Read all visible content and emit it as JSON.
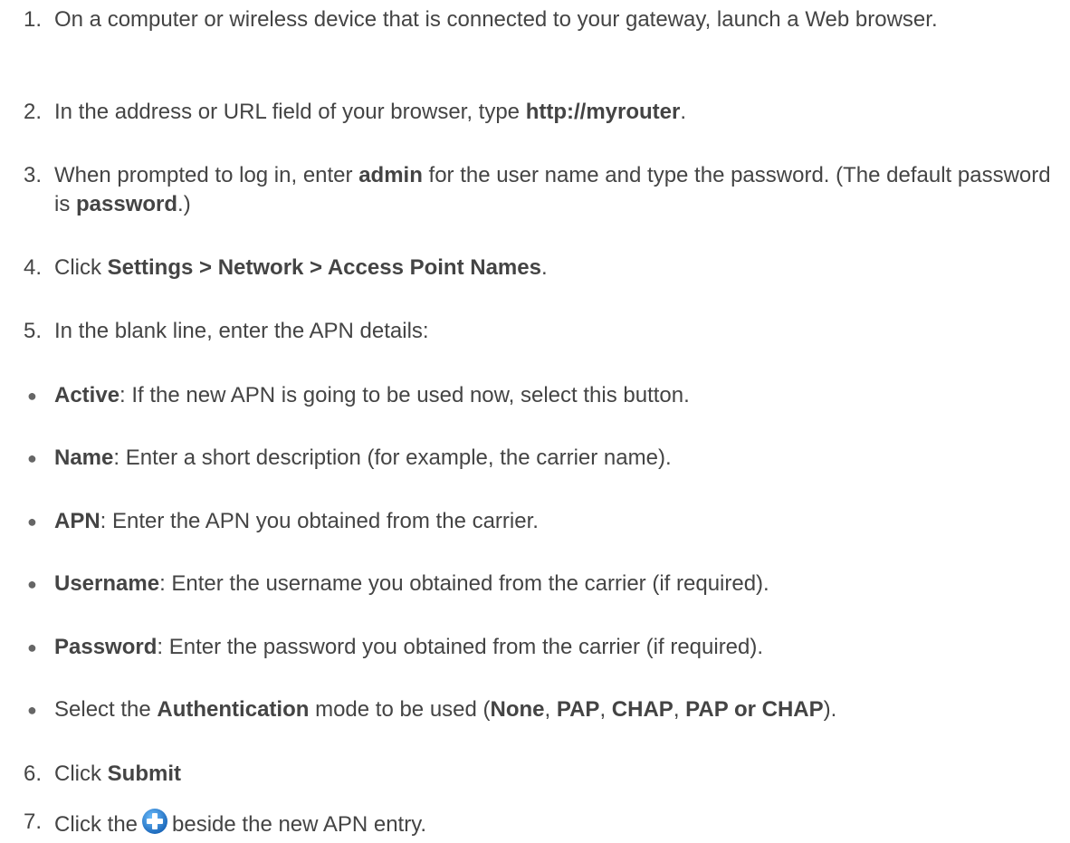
{
  "steps": {
    "s1": {
      "num": "1.",
      "text": "On a computer or wireless device that is connected to your gateway, launch a Web browser."
    },
    "s2": {
      "num": "2.",
      "pre": "In the address or URL field of your browser, type ",
      "bold": "http://myrouter",
      "post": "."
    },
    "s3": {
      "num": "3.",
      "pre": "When prompted to log in, enter ",
      "bold1": "admin",
      "mid": " for the user name and type the password. (The default password is ",
      "bold2": "password",
      "post": ".)"
    },
    "s4": {
      "num": "4.",
      "pre": "Click ",
      "bold": "Settings > Network > Access Point Names",
      "post": "."
    },
    "s5": {
      "num": "5.",
      "text": "In the blank line, enter the APN details:"
    },
    "s6": {
      "num": "6.",
      "pre": "Click ",
      "bold": "Submit"
    },
    "s7": {
      "num": "7.",
      "pre": "Click the",
      "post": "beside the new APN entry.",
      "icon": "plus-circle-icon"
    }
  },
  "bullets": {
    "marker": "●",
    "active": {
      "bold": "Active",
      "text": ": If the new APN is going to be used now, select this button."
    },
    "name": {
      "bold": "Name",
      "text": ": Enter a short description (for example, the carrier name)."
    },
    "apn": {
      "bold": "APN",
      "text": ": Enter the APN you obtained from the carrier."
    },
    "username": {
      "bold": "Username",
      "text": ": Enter the username you obtained from the carrier (if required)."
    },
    "password": {
      "bold": "Password",
      "text": ": Enter the password you obtained from the carrier (if required)."
    },
    "auth": {
      "pre": "Select the ",
      "bold": "Authentication",
      "mid": " mode to be used (",
      "opt1": "None",
      "sep1": ", ",
      "opt2": "PAP",
      "sep2": ", ",
      "opt3": "CHAP",
      "sep3": ", ",
      "opt4": "PAP or CHAP",
      "post": ")."
    }
  },
  "colors": {
    "text": "#444444",
    "icon": "#1f7fd0"
  }
}
